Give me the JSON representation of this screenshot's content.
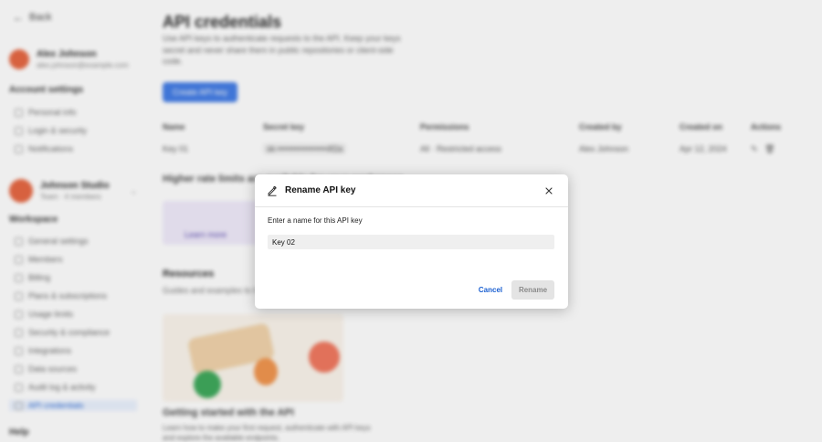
{
  "background": {
    "back_label": "Back",
    "profile": {
      "name": "Alex Johnson",
      "email": "alex.johnson@example.com"
    },
    "sidebar_section1": {
      "title": "Account settings",
      "items": [
        "Personal info",
        "Login & security",
        "Notifications"
      ]
    },
    "workspace": {
      "name": "Johnson Studio",
      "sub": "Team · 4 members"
    },
    "sidebar_section2": {
      "title": "Workspace",
      "items": [
        "General settings",
        "Members",
        "Billing",
        "Plans & subscriptions",
        "Usage limits",
        "Security & compliance",
        "Integrations",
        "Data sources",
        "Audit log & activity",
        "API credentials"
      ],
      "active_index": 9
    },
    "bottom_label": "Help",
    "page_title": "API credentials",
    "page_description": "Use API keys to authenticate requests to the API. Keep your keys secret and never share them in public repositories or client-side code.",
    "create_button": "Create API key",
    "table": {
      "headers": [
        "Name",
        "Secret key",
        "Permissions",
        "Created by",
        "Created on",
        "Actions"
      ],
      "rows": [
        [
          "Key 01",
          "sk-•••••••••••••••••4f2a",
          "All · Restricted access",
          "Alex Johnson",
          "Apr 12, 2024",
          ""
        ]
      ]
    },
    "bulk_title": "Higher rate limits are available for your workspace",
    "promo_link": "Learn more",
    "section2_title": "Resources",
    "section2_sub": "Guides and examples to help you get started with the API",
    "card_title": "Getting started with the API",
    "card_text": "Learn how to make your first request, authenticate with API keys and explore the available endpoints."
  },
  "modal": {
    "title": "Rename API key",
    "field_label": "Enter a name for this API key",
    "input_value": "Key 02",
    "cancel_label": "Cancel",
    "rename_label": "Rename",
    "icons": {
      "header": "edit-icon",
      "close": "close-icon"
    },
    "colors": {
      "link": "#1a5fd1",
      "disabled_bg": "#e4e4e4",
      "disabled_text": "#8a8a8a"
    }
  }
}
